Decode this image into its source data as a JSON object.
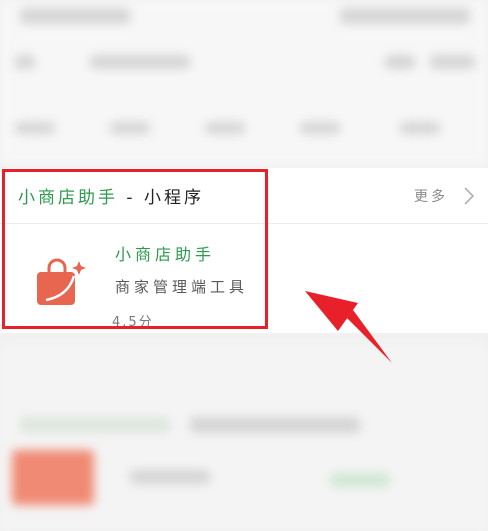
{
  "panel": {
    "title_name": "小商店助手",
    "title_separator": "-",
    "title_type": "小程序",
    "more_label": "更多"
  },
  "app": {
    "name": "小商店助手",
    "description": "商家管理端工具",
    "rating": "4.5分",
    "icon": "shopping-bag-icon",
    "icon_color": "#e8664f"
  },
  "annotation": {
    "highlight_color": "#e8202a",
    "arrow_color": "#e8202a"
  }
}
